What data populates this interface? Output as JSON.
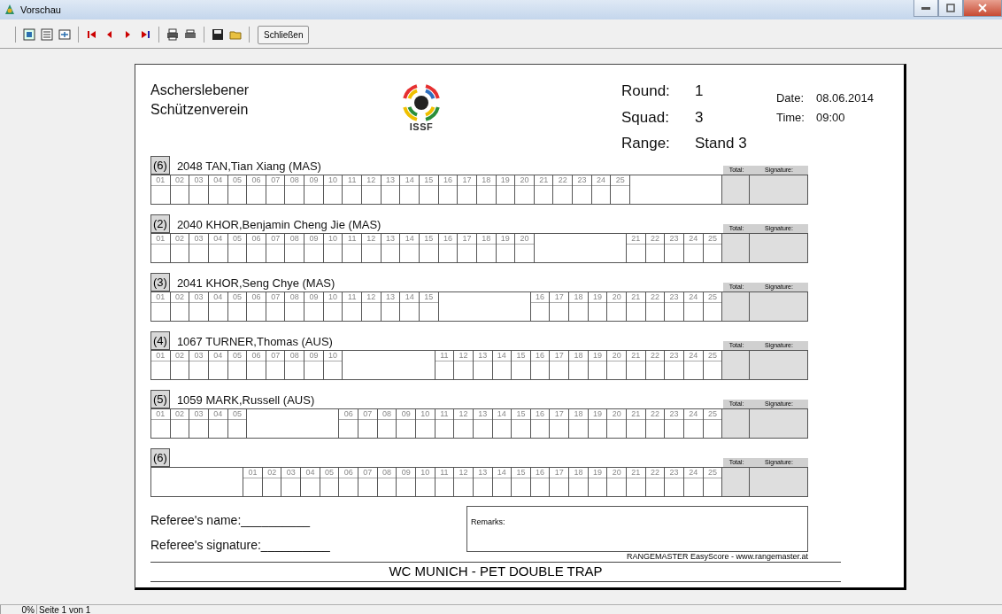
{
  "window": {
    "title": "Vorschau"
  },
  "toolbar": {
    "close_button": "Schließen"
  },
  "sheet": {
    "club": [
      "Ascherslebener",
      "Schützenverein"
    ],
    "logo": {
      "text": "ISSF"
    },
    "info": [
      {
        "label": "Round:",
        "value": "1"
      },
      {
        "label": "Squad:",
        "value": "3"
      },
      {
        "label": "Range:",
        "value": "Stand 3"
      }
    ],
    "meta": [
      {
        "label": "Date:",
        "value": "08.06.2014"
      },
      {
        "label": "Time:",
        "value": "09:00"
      }
    ],
    "shooters": [
      {
        "badge": "(6)",
        "name": "2048 TAN,Tian Xiang (MAS)",
        "total_label": "Total:",
        "signature_label": "Signature:",
        "shots_before_gap": [
          "01",
          "02",
          "03",
          "04",
          "05",
          "06",
          "07",
          "08",
          "09",
          "10",
          "11",
          "12",
          "13",
          "14",
          "15",
          "16",
          "17",
          "18",
          "19",
          "20",
          "21",
          "22",
          "23",
          "24",
          "25"
        ]
      },
      {
        "badge": "(2)",
        "name": "2040 KHOR,Benjamin Cheng Jie (MAS)",
        "total_label": "Total:",
        "signature_label": "Signature:",
        "shots_before_gap": [
          "01",
          "02",
          "03",
          "04",
          "05",
          "06",
          "07",
          "08",
          "09",
          "10",
          "11",
          "12",
          "13",
          "14",
          "15",
          "16",
          "17",
          "18",
          "19",
          "20"
        ],
        "shots_after_gap": [
          "21",
          "22",
          "23",
          "24",
          "25"
        ]
      },
      {
        "badge": "(3)",
        "name": "2041 KHOR,Seng Chye (MAS)",
        "total_label": "Total:",
        "signature_label": "Signature:",
        "shots_before_gap": [
          "01",
          "02",
          "03",
          "04",
          "05",
          "06",
          "07",
          "08",
          "09",
          "10",
          "11",
          "12",
          "13",
          "14",
          "15"
        ],
        "shots_after_gap": [
          "16",
          "17",
          "18",
          "19",
          "20",
          "21",
          "22",
          "23",
          "24",
          "25"
        ]
      },
      {
        "badge": "(4)",
        "name": "1067 TURNER,Thomas (AUS)",
        "total_label": "Total:",
        "signature_label": "Signature:",
        "shots_before_gap": [
          "01",
          "02",
          "03",
          "04",
          "05",
          "06",
          "07",
          "08",
          "09",
          "10"
        ],
        "shots_after_gap": [
          "11",
          "12",
          "13",
          "14",
          "15",
          "16",
          "17",
          "18",
          "19",
          "20",
          "21",
          "22",
          "23",
          "24",
          "25"
        ]
      },
      {
        "badge": "(5)",
        "name": "1059 MARK,Russell (AUS)",
        "total_label": "Total:",
        "signature_label": "Signature:",
        "shots_before_gap": [
          "01",
          "02",
          "03",
          "04",
          "05"
        ],
        "shots_after_gap": [
          "06",
          "07",
          "08",
          "09",
          "10",
          "11",
          "12",
          "13",
          "14",
          "15",
          "16",
          "17",
          "18",
          "19",
          "20",
          "21",
          "22",
          "23",
          "24",
          "25"
        ]
      },
      {
        "badge": "(6)",
        "total_label": "Total:",
        "signature_label": "Signature:",
        "shots_after_gap": [
          "01",
          "02",
          "03",
          "04",
          "05",
          "06",
          "07",
          "08",
          "09",
          "10",
          "11",
          "12",
          "13",
          "14",
          "15",
          "16",
          "17",
          "18",
          "19",
          "20",
          "21",
          "22",
          "23",
          "24",
          "25"
        ]
      }
    ],
    "referee_name": "Referee's name:__________",
    "referee_signature": "Referee's signature:__________",
    "remarks_label": "Remarks:",
    "credit": "RANGEMASTER EasyScore - www.rangemaster.at",
    "event_title": "WC MUNICH - PET DOUBLE TRAP"
  },
  "status_bar": {
    "zoom": "0%",
    "page": "Seite 1 von 1"
  }
}
